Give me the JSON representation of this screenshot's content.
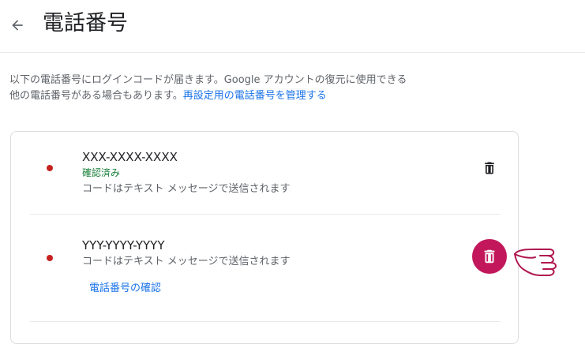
{
  "header": {
    "title": "電話番号",
    "back_icon": "arrow-left-icon"
  },
  "description": {
    "line1": "以下の電話番号にログインコードが届きます。Google アカウントの復元に使用できる",
    "line2": "他の電話番号がある場合もあります。",
    "link": "再設定用の電話番号を管理する"
  },
  "phones": [
    {
      "number": "XXX-XXXX-XXXX",
      "status": "確認済み",
      "method": "コードはテキスト メッセージで送信されます",
      "delete_icon": "trash-icon"
    },
    {
      "number": "YYY-YYYY-YYYY",
      "method": "コードはテキスト メッセージで送信されます",
      "verify_link": "電話番号の確認",
      "delete_icon": "trash-icon"
    }
  ],
  "colors": {
    "accent": "#1a73e8",
    "verified": "#188038",
    "bullet": "#c5221f",
    "highlight": "#c2185b"
  }
}
